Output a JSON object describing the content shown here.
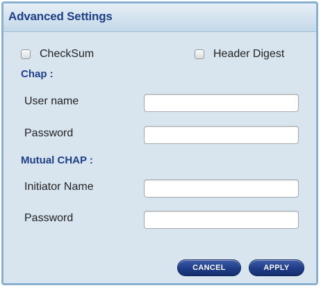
{
  "dialog": {
    "title": "Advanced Settings"
  },
  "options": {
    "checksum_label": "CheckSum",
    "checksum_checked": false,
    "header_digest_label": "Header Digest",
    "header_digest_checked": false
  },
  "chap": {
    "heading": "Chap :",
    "username_label": "User name",
    "username_value": "",
    "password_label": "Password",
    "password_value": ""
  },
  "mutual_chap": {
    "heading": "Mutual CHAP :",
    "initiator_label": "Initiator Name",
    "initiator_value": "",
    "password_label": "Password",
    "password_value": ""
  },
  "buttons": {
    "cancel": "CANCEL",
    "apply": "APPLY"
  },
  "colors": {
    "accent": "#1e3f86",
    "panel_bg": "#d8e5ef",
    "border": "#8ab0cf"
  }
}
